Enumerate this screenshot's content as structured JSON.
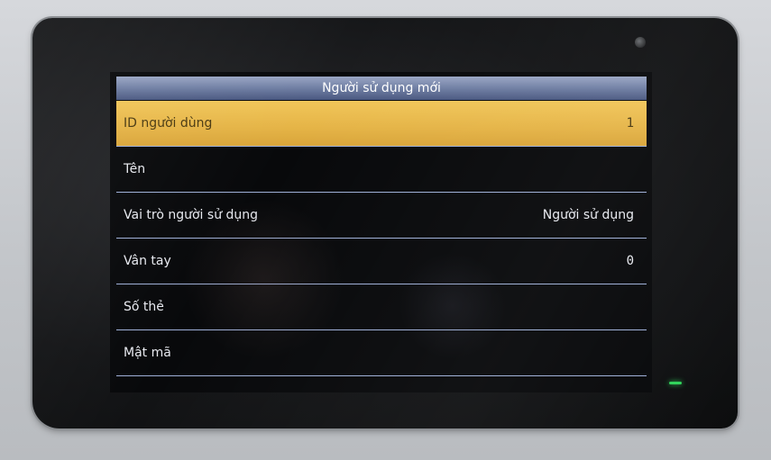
{
  "screen": {
    "title": "Người sử dụng mới",
    "rows": [
      {
        "label": "ID người dùng",
        "value": "1"
      },
      {
        "label": "Tên",
        "value": ""
      },
      {
        "label": "Vai trò người sử dụng",
        "value": "Người sử dụng"
      },
      {
        "label": "Vân tay",
        "value": "0"
      },
      {
        "label": "Số thẻ",
        "value": ""
      },
      {
        "label": "Mật mã",
        "value": ""
      }
    ],
    "selected_index": 0
  },
  "colors": {
    "title_bar": "#6f7ea3",
    "selected_row": "#e5b447",
    "divider": "#9fb0d8",
    "status_led": "#2fd35a"
  }
}
